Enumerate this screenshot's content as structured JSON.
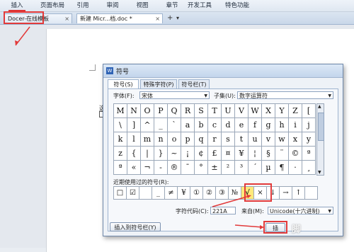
{
  "menu": [
    "插入",
    "页面布局",
    "引用",
    "审阅",
    "视图",
    "章节",
    "开发工具",
    "特色功能"
  ],
  "tabs": [
    {
      "label": "Docer-在线模板",
      "close": "×"
    },
    {
      "label": "新建 Micr...档.doc *",
      "close": "×"
    }
  ],
  "tab_add": "+",
  "tab_dropdown": "▾",
  "doc_text": "选",
  "dialog": {
    "title": "符号",
    "tabs": [
      "符号(S)",
      "特殊字符(P)",
      "符号栏(T)"
    ],
    "font_label": "字体(F):",
    "font_value": "宋体",
    "subset_label": "子集(U):",
    "subset_value": "数字运算符",
    "grid": [
      [
        "M",
        "N",
        "O",
        "P",
        "Q",
        "R",
        "S",
        "T",
        "U",
        "V",
        "W",
        "X",
        "Y",
        "Z",
        "["
      ],
      [
        "\\",
        "]",
        "^",
        "_",
        "`",
        "a",
        "b",
        "c",
        "d",
        "e",
        "f",
        "g",
        "h",
        "i",
        "j"
      ],
      [
        "k",
        "l",
        "m",
        "n",
        "o",
        "p",
        "q",
        "r",
        "s",
        "t",
        "u",
        "v",
        "w",
        "x",
        "y"
      ],
      [
        "z",
        "{",
        "|",
        "}",
        "~",
        "¡",
        "¢",
        "£",
        "¤",
        "¥",
        "¦",
        "§",
        "¨",
        "©",
        "ª"
      ],
      [
        "ª",
        "«",
        "¬",
        "-",
        "®",
        "¯",
        "°",
        "±",
        "²",
        "³",
        "´",
        "µ",
        "¶",
        "·",
        "¸"
      ]
    ],
    "recent_label": "近期使用过的符号(R):",
    "recent": [
      "□",
      "☑",
      "",
      "_",
      "≠",
      "¥",
      "①",
      "②",
      "③",
      "№",
      "√",
      "×",
      "↓",
      "→",
      "↑",
      ""
    ],
    "code_label": "字符代码(C):",
    "code_value": "221A",
    "from_label": "来自(M):",
    "from_value": "Unicode(十六进制)",
    "insert_to_bar_btn": "插入到符号栏(Y)",
    "insert_btn": "插"
  },
  "watermark": "脚"
}
